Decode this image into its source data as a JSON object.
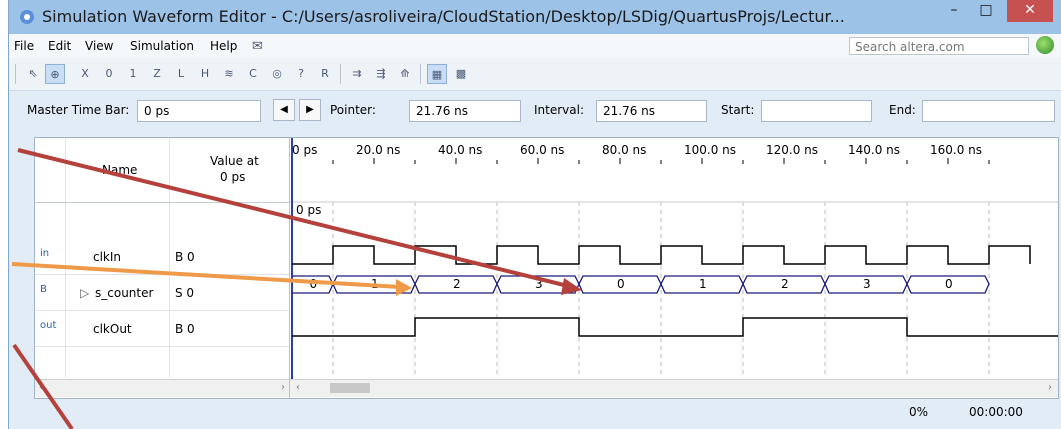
{
  "window": {
    "title": "Simulation Waveform Editor - C:/Users/asroliveira/CloudStation/Desktop/LSDig/QuartusProjs/Lectur...",
    "minimize": "–",
    "maximize": "□",
    "close": "✕"
  },
  "menu": [
    "File",
    "Edit",
    "View",
    "Simulation",
    "Help"
  ],
  "search": {
    "placeholder": "Search altera.com"
  },
  "timebar": {
    "master_label": "Master Time Bar:",
    "master_value": "0 ps",
    "pointer_label": "Pointer:",
    "pointer_value": "21.76 ns",
    "interval_label": "Interval:",
    "interval_value": "21.76 ns",
    "start_label": "Start:",
    "start_value": "",
    "end_label": "End:",
    "end_value": ""
  },
  "table": {
    "name_header": "Name",
    "value_header_line1": "Value at",
    "value_header_line2": "0 ps",
    "signals": [
      {
        "icon": "in",
        "name": "clkIn",
        "value": "B 0"
      },
      {
        "icon": "B",
        "name": "s_counter",
        "value": "S 0",
        "expander": "▷"
      },
      {
        "icon": "out",
        "name": "clkOut",
        "value": "B 0"
      }
    ]
  },
  "timeline": {
    "ticks": [
      "0 ps",
      "20.0 ns",
      "40.0 ns",
      "60.0 ns",
      "80.0 ns",
      "100.0 ns",
      "120.0 ns",
      "140.0 ns",
      "160.0 ns"
    ],
    "cursor_label": "0 ps",
    "counter_states": [
      "0",
      "1",
      "2",
      "3",
      "0",
      "1",
      "2",
      "3",
      "0"
    ]
  },
  "status": {
    "progress": "0%",
    "time": "00:00:00"
  },
  "colors": {
    "bus": "#1a1a7a",
    "arrow_red": "#b5413c",
    "arrow_orange": "#ee9a48"
  }
}
